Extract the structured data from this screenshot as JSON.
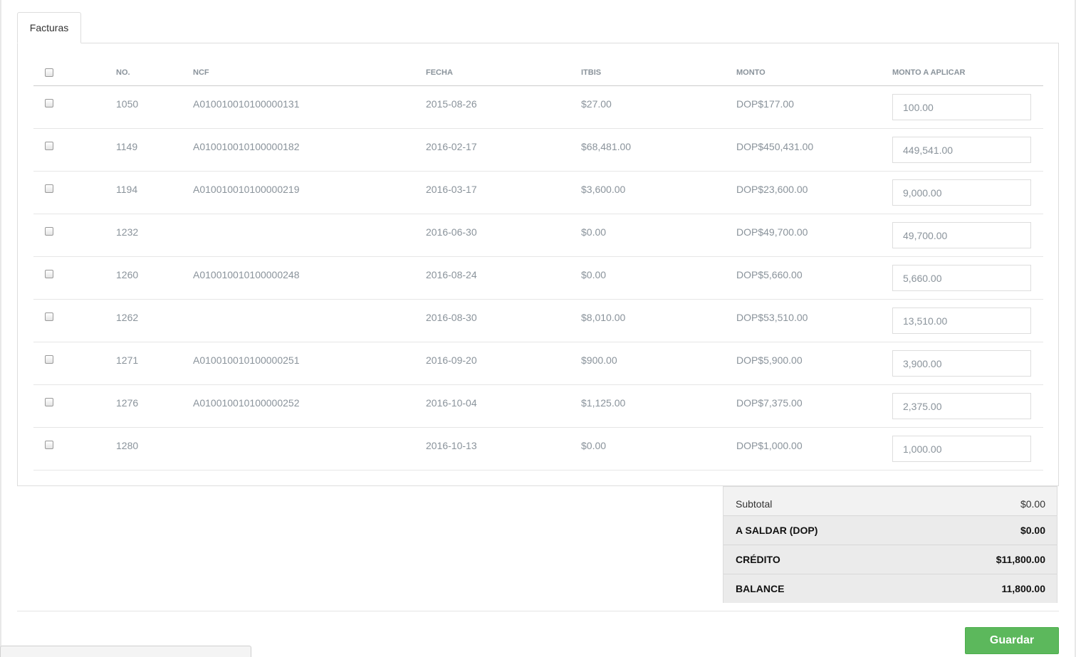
{
  "tabs": {
    "active_label": "Facturas"
  },
  "table": {
    "headers": {
      "no": "NO.",
      "ncf": "NCF",
      "fecha": "FECHA",
      "itbis": "ITBIS",
      "monto": "MONTO",
      "monto_aplicar": "MONTO A APLICAR"
    },
    "rows": [
      {
        "no": "1050",
        "ncf": "A010010010100000131",
        "fecha": "2015-08-26",
        "itbis": "$27.00",
        "monto": "DOP$177.00",
        "aplicar": "100.00"
      },
      {
        "no": "1149",
        "ncf": "A010010010100000182",
        "fecha": "2016-02-17",
        "itbis": "$68,481.00",
        "monto": "DOP$450,431.00",
        "aplicar": "449,541.00"
      },
      {
        "no": "1194",
        "ncf": "A010010010100000219",
        "fecha": "2016-03-17",
        "itbis": "$3,600.00",
        "monto": "DOP$23,600.00",
        "aplicar": "9,000.00"
      },
      {
        "no": "1232",
        "ncf": "",
        "fecha": "2016-06-30",
        "itbis": "$0.00",
        "monto": "DOP$49,700.00",
        "aplicar": "49,700.00"
      },
      {
        "no": "1260",
        "ncf": "A010010010100000248",
        "fecha": "2016-08-24",
        "itbis": "$0.00",
        "monto": "DOP$5,660.00",
        "aplicar": "5,660.00"
      },
      {
        "no": "1262",
        "ncf": "",
        "fecha": "2016-08-30",
        "itbis": "$8,010.00",
        "monto": "DOP$53,510.00",
        "aplicar": "13,510.00"
      },
      {
        "no": "1271",
        "ncf": "A010010010100000251",
        "fecha": "2016-09-20",
        "itbis": "$900.00",
        "monto": "DOP$5,900.00",
        "aplicar": "3,900.00"
      },
      {
        "no": "1276",
        "ncf": "A010010010100000252",
        "fecha": "2016-10-04",
        "itbis": "$1,125.00",
        "monto": "DOP$7,375.00",
        "aplicar": "2,375.00"
      },
      {
        "no": "1280",
        "ncf": "",
        "fecha": "2016-10-13",
        "itbis": "$0.00",
        "monto": "DOP$1,000.00",
        "aplicar": "1,000.00"
      }
    ]
  },
  "totals": {
    "subtotal_label": "Subtotal",
    "subtotal_value": "$0.00",
    "a_saldar_label": "A SALDAR (DOP)",
    "a_saldar_value": "$0.00",
    "credito_label": "CRÉDITO",
    "credito_value": "$11,800.00",
    "balance_label": "BALANCE",
    "balance_value": "11,800.00"
  },
  "actions": {
    "save_label": "Guardar"
  },
  "colors": {
    "accent_green": "#5cb85c",
    "muted_text": "#8a939b"
  }
}
